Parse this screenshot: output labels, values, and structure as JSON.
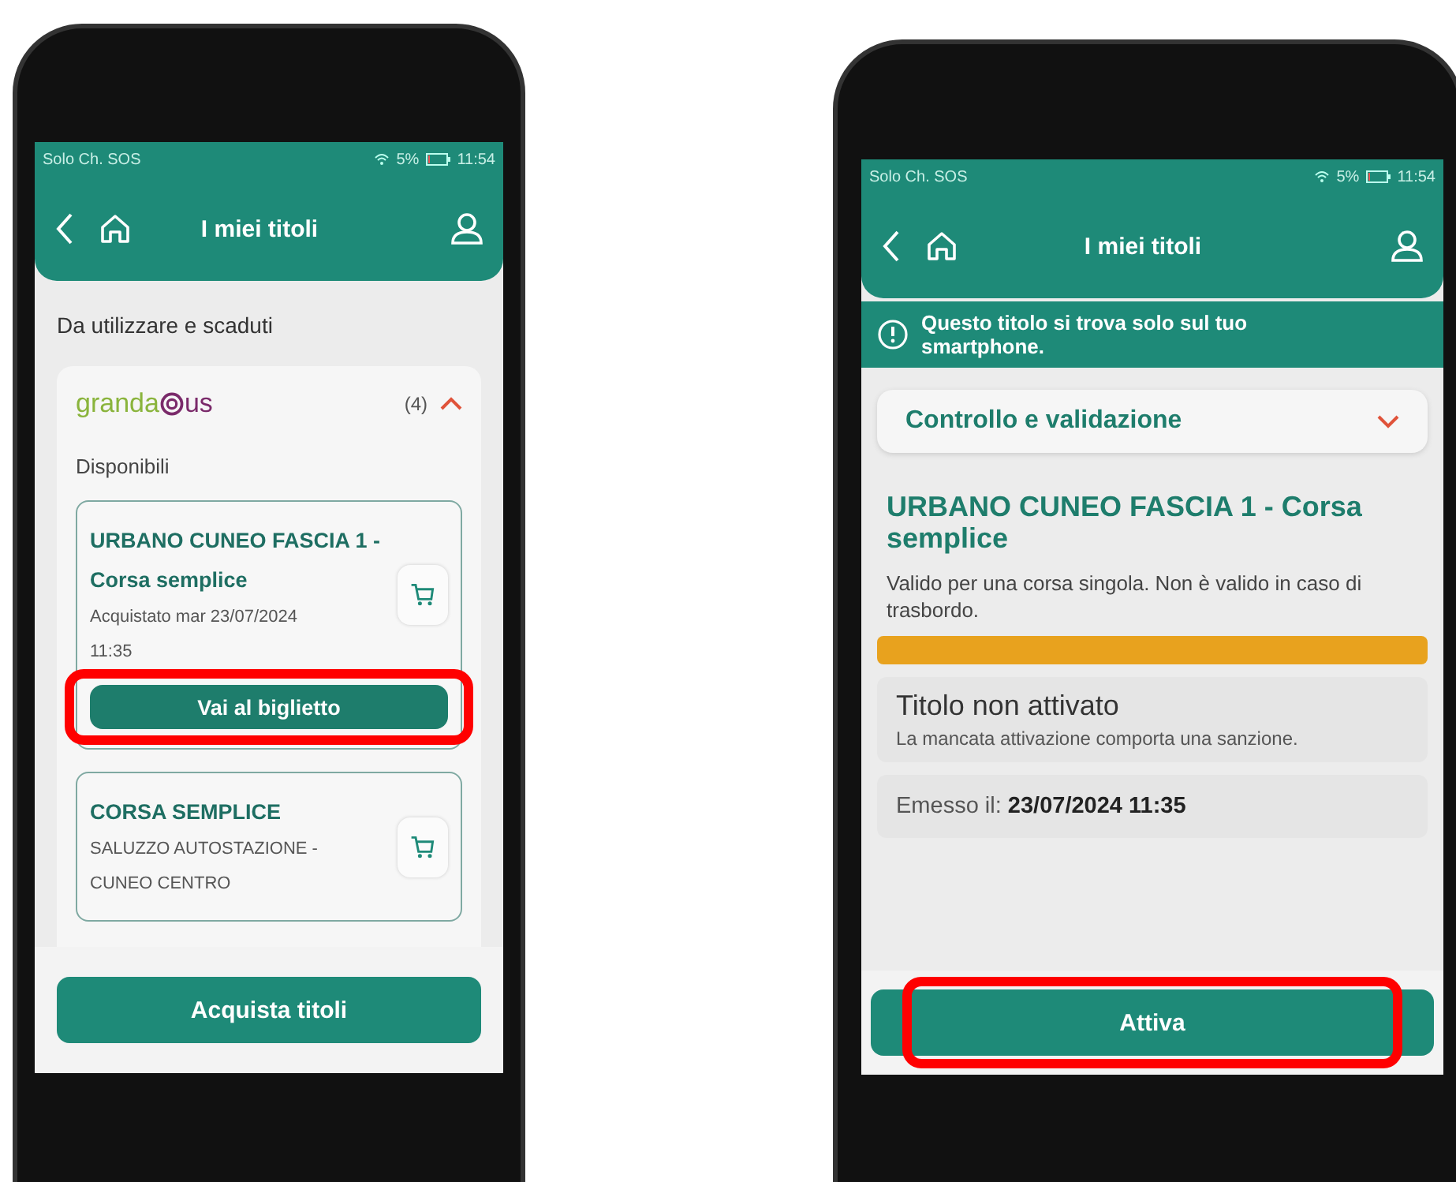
{
  "left_phone": {
    "status_bar": {
      "carrier": "Solo Ch. SOS",
      "battery": "5%",
      "time": "11:54"
    },
    "header": {
      "title": "I miei titoli"
    },
    "section_title": "Da utilizzare e scaduti",
    "operator": {
      "logo_start": "granda",
      "logo_end": "us",
      "count": "(4)",
      "expanded": true
    },
    "subsection": "Disponibili",
    "tickets": [
      {
        "title": "URBANO CUNEO FASCIA 1 - Corsa semplice",
        "details": [
          "Acquistato mar 23/07/2024",
          "11:35"
        ],
        "button": "Vai al biglietto",
        "highlighted": true
      },
      {
        "title": "CORSA SEMPLICE",
        "details": [
          "SALUZZO AUTOSTAZIONE -",
          "CUNEO CENTRO"
        ]
      }
    ],
    "bottom_button": {
      "label": "Acquista titoli"
    }
  },
  "right_phone": {
    "status_bar": {
      "carrier": "Solo Ch. SOS",
      "battery": "5%",
      "time": "11:54"
    },
    "header": {
      "title": "I miei titoli"
    },
    "notice": "Questo titolo si trova solo sul tuo smartphone.",
    "accordion": {
      "label": "Controllo e validazione",
      "expanded": false
    },
    "ticket_title": "URBANO CUNEO FASCIA 1 - Corsa semplice",
    "description": "Valido per una corsa singola. Non è valido in caso di trasbordo.",
    "validity_bar": {
      "level": 1
    },
    "status": {
      "title": "Titolo non attivato",
      "text": "La mancata attivazione comporta una sanzione."
    },
    "issued": "Emesso il: **23/07/2024 11:35**",
    "bottom_button": {
      "label": "Attiva",
      "highlighted": true
    }
  }
}
